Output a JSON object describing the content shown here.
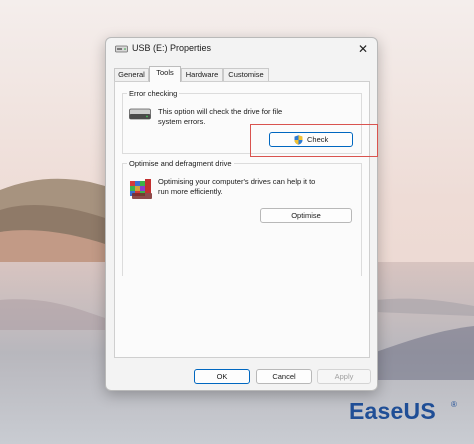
{
  "window": {
    "title": "USB (E:) Properties",
    "close_glyph": "✕"
  },
  "tabs": [
    {
      "label": "General",
      "active": false
    },
    {
      "label": "Tools",
      "active": true
    },
    {
      "label": "Hardware",
      "active": false
    },
    {
      "label": "Customise",
      "active": false
    }
  ],
  "error_checking": {
    "title": "Error checking",
    "description_line1": "This option will check the drive for file",
    "description_line2": "system errors.",
    "icon": "drive-icon",
    "button_label": "Check",
    "button_icon": "shield-icon"
  },
  "optimise": {
    "title": "Optimise and defragment drive",
    "description_line1": "Optimising your computer's drives can help it to",
    "description_line2": "run more efficiently.",
    "icon": "defrag-icon",
    "button_label": "Optimise"
  },
  "footer": {
    "ok_label": "OK",
    "cancel_label": "Cancel",
    "apply_label": "Apply"
  },
  "watermark": {
    "brand": "EaseUS",
    "registered": "®"
  },
  "colors": {
    "highlight": "#d9534f",
    "brand": "#1f4e96",
    "accent": "#0067c0"
  }
}
